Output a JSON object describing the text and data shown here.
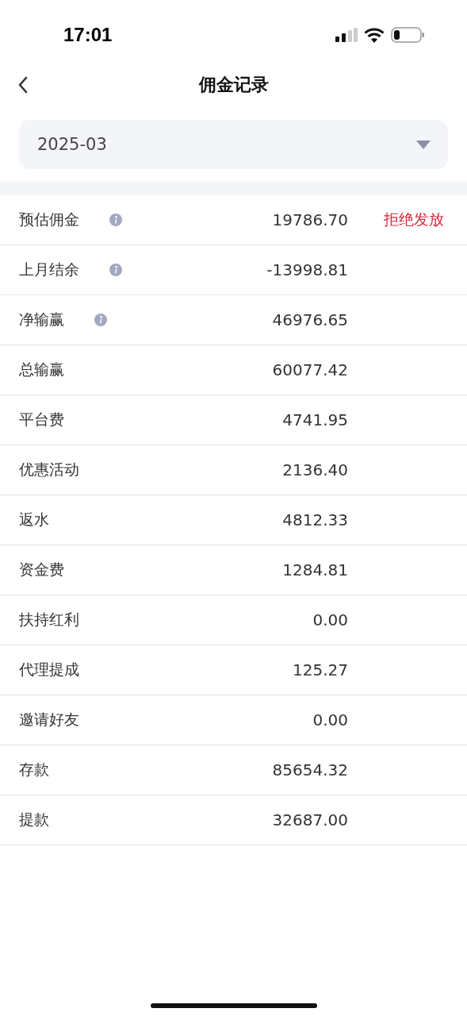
{
  "status_bar": {
    "time": "17:01"
  },
  "header": {
    "title": "佣金记录"
  },
  "month_picker": {
    "value": "2025-03"
  },
  "rows": [
    {
      "label": "预估佣金",
      "info": true,
      "value": "19786.70",
      "action": "拒绝发放"
    },
    {
      "label": "上月结余",
      "info": true,
      "value": "-13998.81"
    },
    {
      "label": "净输赢",
      "info": true,
      "value": "46976.65"
    },
    {
      "label": "总输赢",
      "info": false,
      "value": "60077.42"
    },
    {
      "label": "平台费",
      "info": false,
      "value": "4741.95"
    },
    {
      "label": "优惠活动",
      "info": false,
      "value": "2136.40"
    },
    {
      "label": "返水",
      "info": false,
      "value": "4812.33"
    },
    {
      "label": "资金费",
      "info": false,
      "value": "1284.81"
    },
    {
      "label": "扶持红利",
      "info": false,
      "value": "0.00"
    },
    {
      "label": "代理提成",
      "info": false,
      "value": "125.27"
    },
    {
      "label": "邀请好友",
      "info": false,
      "value": "0.00"
    },
    {
      "label": "存款",
      "info": false,
      "value": "85654.32"
    },
    {
      "label": "提款",
      "info": false,
      "value": "32687.00"
    }
  ]
}
